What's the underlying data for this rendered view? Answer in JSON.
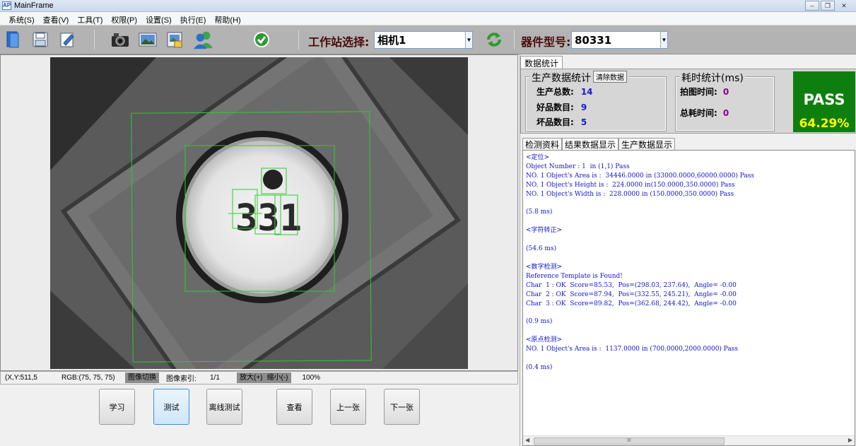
{
  "window": {
    "title": "MainFrame",
    "app_icon": "AP"
  },
  "menu": [
    "系统(S)",
    "查看(V)",
    "工具(T)",
    "权限(P)",
    "设置(S)",
    "执行(E)",
    "帮助(H)"
  ],
  "toolbar": {
    "station_label": "工作站选择:",
    "station_value": "相机1",
    "part_label": "器件型号:",
    "part_value": "80331",
    "icons": [
      "open-book-icon",
      "save-icon",
      "edit-icon",
      "camera-icon",
      "image-icon",
      "image-save-icon",
      "users-icon",
      "check-ok-icon",
      "refresh-icon"
    ]
  },
  "image_view": {
    "digits": "331"
  },
  "status": {
    "coords": "(X,Y:511,5",
    "rgb": "RGB:(75, 75, 75)",
    "switch_btn": "图像切换",
    "index_label": "图像索引:",
    "index_value": "1/1",
    "zoom_in": "放大(+)",
    "zoom_out": "缩小(-)",
    "zoom_value": "100%"
  },
  "buttons": [
    "学习",
    "测试",
    "离线测试",
    "查看",
    "上一张",
    "下一张"
  ],
  "right": {
    "top_tab": "数据统计",
    "prod_title": "生产数据统计",
    "clear_btn": "清除数据",
    "total_label": "生产总数:",
    "total_value": "14",
    "good_label": "好品数目:",
    "good_value": "9",
    "bad_label": "坏品数目:",
    "bad_value": "5",
    "time_title": "耗时统计(ms)",
    "shot_label": "拍图时间:",
    "shot_value": "0",
    "total_time_label": "总耗时间:",
    "total_time_value": "0",
    "result": "PASS",
    "rate": "64.29%",
    "tabs": [
      "检测资料",
      "结果数据显示",
      "生产数据显示"
    ],
    "log": [
      "<定位>",
      "Object Number : 1  in (1,1) Pass",
      "NO. 1 Object's Area is :  34446.0000 in (33000.0000,60000.0000) Pass",
      "NO. 1 Object's Height is :  224.0000 in(150.0000,350.0000) Pass",
      "NO. 1 Object's Width is :  228.0000 in (150.0000,350.0000) Pass",
      "",
      "(5.8 ms)",
      "",
      "<字符转正>",
      "",
      "(54.6 ms)",
      "",
      "<数字检测>",
      "Reference Template is Found!",
      "Char  1 : OK  Score=85.53,  Pos=(298.03, 237.64),  Angle= -0.00",
      "Char  2 : OK  Score=87.94,  Pos=(332.55, 245.21),  Angle= -0.00",
      "Char  3 : OK  Score=89.82,  Pos=(362.68, 244.42),  Angle= -0.00",
      "",
      "(0.9 ms)",
      "",
      "<原点检测>",
      "NO. 1 Object's Area is :  1137.0000 in (700.0000,2000.0000) Pass",
      "",
      "(0.4 ms)"
    ],
    "scroll_mark": "III"
  },
  "colors": {
    "pass_bg": "#0e7f0e",
    "pass_text": "#ffffff",
    "rate_text": "#ffff00",
    "log_text": "#1414c8",
    "roi": "#2ecc2e"
  }
}
